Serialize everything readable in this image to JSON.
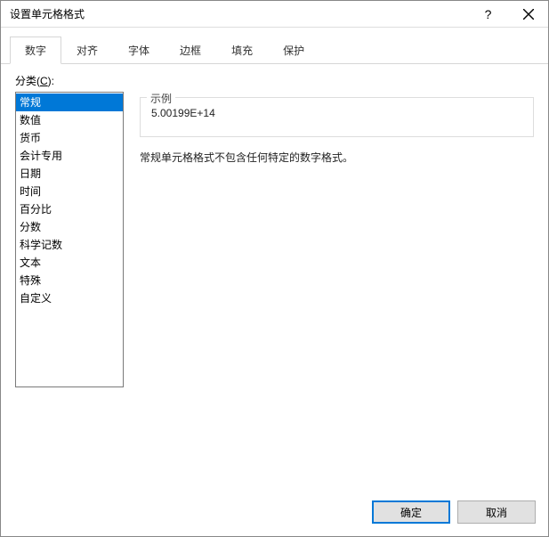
{
  "window": {
    "title": "设置单元格格式",
    "help_label": "?",
    "close_label": "×"
  },
  "tabs": [
    {
      "label": "数字",
      "active": true
    },
    {
      "label": "对齐",
      "active": false
    },
    {
      "label": "字体",
      "active": false
    },
    {
      "label": "边框",
      "active": false
    },
    {
      "label": "填充",
      "active": false
    },
    {
      "label": "保护",
      "active": false
    }
  ],
  "category": {
    "label_prefix": "分类(",
    "label_underlined": "C",
    "label_suffix": "):",
    "items": [
      "常规",
      "数值",
      "货币",
      "会计专用",
      "日期",
      "时间",
      "百分比",
      "分数",
      "科学记数",
      "文本",
      "特殊",
      "自定义"
    ],
    "selected_index": 0
  },
  "sample": {
    "label": "示例",
    "value": "5.00199E+14"
  },
  "description": "常规单元格格式不包含任何特定的数字格式。",
  "buttons": {
    "ok": "确定",
    "cancel": "取消"
  }
}
